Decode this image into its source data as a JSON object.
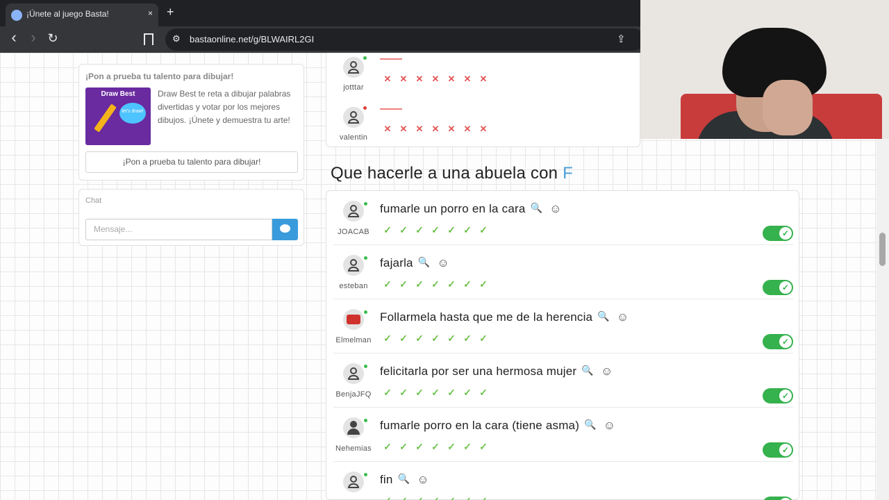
{
  "browser": {
    "tab_title": "¡Únete al juego Basta!",
    "tab_close": "×",
    "new_tab": "+",
    "back": "‹",
    "forward": "›",
    "reload": "↻",
    "site_icon": "⚙",
    "url": "bastaonline.net/g/BLWAIRL2GI",
    "share": "⇪"
  },
  "promo": {
    "title": "¡Pon a prueba tu talento para dibujar!",
    "image_title": "Draw Best",
    "image_bubble": "let's draw!",
    "text": "Draw Best te reta a dibujar palabras divertidas y votar por los mejores dibujos. ¡Únete y demuestra tu arte!",
    "button_label": "¡Pon a prueba tu talento para dibujar!"
  },
  "chat": {
    "label": "Chat",
    "placeholder": "Mensaje..."
  },
  "previous_players": [
    {
      "username": "jotttar",
      "status": "online",
      "votes": [
        "no",
        "no",
        "no",
        "no",
        "no",
        "no",
        "no"
      ]
    },
    {
      "username": "valentin",
      "status": "offline",
      "votes": [
        "no",
        "no",
        "no",
        "no",
        "no",
        "no",
        "no"
      ]
    }
  ],
  "question": {
    "prefix": "Que hacerle a una abuela con",
    "letter": "F"
  },
  "answers": [
    {
      "username": "JOACAB",
      "avatar": "default",
      "text": "fumarle un porro en la cara",
      "votes": [
        "yes",
        "yes",
        "yes",
        "yes",
        "yes",
        "yes",
        "yes"
      ],
      "accepted": true
    },
    {
      "username": "esteban",
      "avatar": "default",
      "text": "fajarla",
      "votes": [
        "yes",
        "yes",
        "yes",
        "yes",
        "yes",
        "yes",
        "yes"
      ],
      "accepted": true
    },
    {
      "username": "Elmelman",
      "avatar": "stop-sign",
      "text": "Follarmela hasta que me de la herencia",
      "votes": [
        "yes",
        "yes",
        "yes",
        "yes",
        "yes",
        "yes",
        "yes"
      ],
      "accepted": true
    },
    {
      "username": "BenjaJFQ",
      "avatar": "default",
      "text": "felicitarla por ser una hermosa mujer",
      "votes": [
        "yes",
        "yes",
        "yes",
        "yes",
        "yes",
        "yes",
        "yes"
      ],
      "accepted": true
    },
    {
      "username": "Nehemias",
      "avatar": "solid",
      "text": "fumarle porro en la cara (tiene asma)",
      "votes": [
        "yes",
        "yes",
        "yes",
        "yes",
        "yes",
        "yes",
        "yes"
      ],
      "accepted": true
    },
    {
      "username": "",
      "avatar": "default",
      "text": "fin",
      "votes": [
        "yes",
        "yes",
        "yes",
        "yes",
        "yes",
        "yes",
        "yes"
      ],
      "accepted": true
    }
  ],
  "icons": {
    "search": "🔍",
    "react": "☺",
    "vote_yes": "✓",
    "vote_no": "✕",
    "toggle_check": "✓"
  },
  "colors": {
    "accent": "#4a9fd8",
    "toggle_on": "#35b14d",
    "vote_yes": "#6cc04a",
    "vote_no": "#e05555",
    "online": "#3cbc4d",
    "offline": "#e0403c"
  }
}
